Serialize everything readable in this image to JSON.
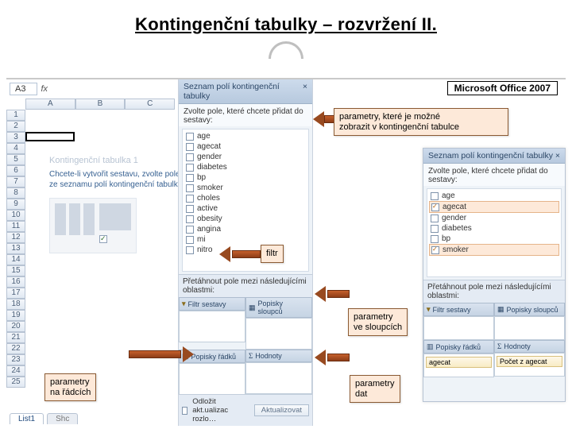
{
  "slide": {
    "title": "Kontingenční tabulky – rozvržení II.",
    "badge": "Microsoft Office 2007"
  },
  "callouts": {
    "fieldsLine1": "parametry, které je možné",
    "fieldsLine2": "zobrazit v kontingenční tabulce",
    "filter": "filtr",
    "colsLine1": "parametry",
    "colsLine2": "ve sloupcích",
    "rowsLine1": "parametry",
    "rowsLine2": "na řádcích",
    "dataLine1": "parametry",
    "dataLine2": "dat"
  },
  "excel": {
    "cellRef": "A3",
    "fx": "fx",
    "columns": [
      "A",
      "B",
      "C"
    ],
    "rows": [
      "1",
      "2",
      "3",
      "4",
      "5",
      "6",
      "7",
      "8",
      "9",
      "10",
      "11",
      "12",
      "13",
      "14",
      "15",
      "16",
      "17",
      "18",
      "19",
      "20",
      "21",
      "22",
      "23",
      "24",
      "25"
    ],
    "pivotTitle": "Kontingenční tabulka 1",
    "pivotText": "Chcete-li vytvořit sestavu, zvolte pole ze seznamu polí kontingenční tabulky.",
    "sheetTabs": {
      "active": "List1",
      "next": "Shc"
    }
  },
  "taskpane": {
    "title": "Seznam polí kontingenční tabulky",
    "close": "×",
    "prompt": "Zvolte pole, které chcete přidat do sestavy:",
    "fields": [
      "age",
      "agecat",
      "gender",
      "diabetes",
      "bp",
      "smoker",
      "choles",
      "active",
      "obesity",
      "angina",
      "mi",
      "nitro"
    ],
    "dragHeader": "Přetáhnout pole mezi následujícími oblastmi:",
    "zones": {
      "filter": "Filtr sestavy",
      "columns": "Popisky sloupců",
      "rows": "Popisky řádků",
      "values": "Hodnoty"
    },
    "sigma": "Σ",
    "deferLabel": "Odložit akt.ualizac rozlo…",
    "updateBtn": "Aktualizovat"
  },
  "rightpane": {
    "title": "Seznam polí kontingenční tabulky",
    "prompt": "Zvolte pole, které chcete přidat do sestavy:",
    "fields": [
      {
        "name": "age",
        "checked": false,
        "hl": false
      },
      {
        "name": "agecat",
        "checked": true,
        "hl": true
      },
      {
        "name": "gender",
        "checked": false,
        "hl": false
      },
      {
        "name": "diabetes",
        "checked": false,
        "hl": false
      },
      {
        "name": "bp",
        "checked": false,
        "hl": false
      },
      {
        "name": "smoker",
        "checked": true,
        "hl": true
      }
    ],
    "dragHeader": "Přetáhnout pole mezi následujícími oblastmi:",
    "rowItem": "agecat",
    "valItem": "Počet z agecat"
  }
}
